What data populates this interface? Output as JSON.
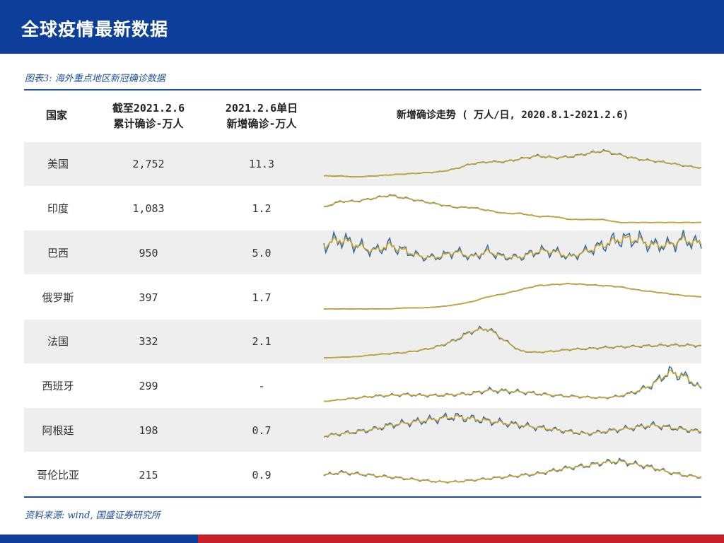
{
  "page": {
    "title": "全球疫情最新数据"
  },
  "figure": {
    "caption": "图表3: 海外重点地区新冠确诊数据",
    "source": "资料来源: wind, 国盛证券研究所"
  },
  "table": {
    "headers": {
      "country": "国家",
      "cumulative_l1": "截至2021.2.6",
      "cumulative_l2": "累计确诊-万人",
      "daily_l1": "2021.2.6单日",
      "daily_l2": "新增确诊-万人",
      "trend": "新增确诊走势 ( 万人/日, 2020.8.1-2021.2.6)"
    },
    "rows": [
      {
        "country": "美国",
        "cumulative": "2,752",
        "daily": "11.3"
      },
      {
        "country": "印度",
        "cumulative": "1,083",
        "daily": "1.2"
      },
      {
        "country": "巴西",
        "cumulative": "950",
        "daily": "5.0"
      },
      {
        "country": "俄罗斯",
        "cumulative": "397",
        "daily": "1.7"
      },
      {
        "country": "法国",
        "cumulative": "332",
        "daily": "2.1"
      },
      {
        "country": "西班牙",
        "cumulative": "299",
        "daily": "-"
      },
      {
        "country": "阿根廷",
        "cumulative": "198",
        "daily": "0.7"
      },
      {
        "country": "哥伦比亚",
        "cumulative": "215",
        "daily": "0.9"
      }
    ]
  },
  "colors": {
    "header_blue": "#0d3f9a",
    "accent_red": "#c8202a",
    "line_blue": "#2e6db4",
    "line_gold": "#c9a227",
    "band_gray": "#eeeeee"
  },
  "chart_data": {
    "type": "line",
    "title": "新增确诊走势 ( 万人/日, 2020.8.1-2021.2.6)",
    "x_range": [
      "2020.8.1",
      "2021.2.6"
    ],
    "sparklines": [
      {
        "country": "美国",
        "keypoints": [
          5,
          5,
          4,
          5,
          6,
          7,
          8,
          9,
          12,
          17,
          19,
          19,
          22,
          25,
          23,
          24,
          27,
          30,
          26,
          22,
          20,
          18,
          15,
          13
        ]
      },
      {
        "country": "印度",
        "keypoints": [
          6,
          8,
          8,
          9,
          10,
          9,
          8,
          7,
          6,
          6,
          5,
          4,
          4,
          3,
          3,
          2,
          2,
          2,
          1,
          1,
          1,
          1,
          1,
          1
        ]
      },
      {
        "country": "巴西",
        "keypoints": [
          4,
          5,
          4,
          3,
          4,
          3,
          2,
          2,
          3,
          2,
          3,
          2,
          2,
          3,
          3,
          2,
          3,
          4,
          5,
          5,
          4,
          4,
          5,
          4
        ]
      },
      {
        "country": "俄罗斯",
        "keypoints": [
          0.5,
          0.5,
          0.5,
          0.5,
          0.5,
          0.6,
          0.6,
          0.7,
          0.9,
          1.2,
          1.7,
          2.0,
          2.4,
          2.8,
          2.9,
          3.0,
          2.9,
          2.8,
          2.7,
          2.4,
          2.2,
          2.0,
          1.8,
          1.7
        ]
      },
      {
        "country": "法国",
        "keypoints": [
          0.1,
          0.2,
          0.3,
          0.6,
          0.8,
          1.0,
          1.4,
          2.0,
          3.0,
          4.5,
          5.0,
          3.0,
          1.2,
          1.0,
          1.2,
          1.5,
          1.6,
          1.8,
          1.9,
          2.0,
          2.1,
          2.2,
          2.2,
          2.1
        ]
      },
      {
        "country": "西班牙",
        "keypoints": [
          0.1,
          0.3,
          0.5,
          0.7,
          0.8,
          0.9,
          0.8,
          0.8,
          0.9,
          1.0,
          1.4,
          1.3,
          1.2,
          1.0,
          0.8,
          0.7,
          0.6,
          0.5,
          0.7,
          1.2,
          2.0,
          3.5,
          3.0,
          1.5
        ]
      },
      {
        "country": "阿根廷",
        "keypoints": [
          0.5,
          0.6,
          0.7,
          0.8,
          1.0,
          1.1,
          1.2,
          1.3,
          1.4,
          1.3,
          1.2,
          1.1,
          1.0,
          0.9,
          0.8,
          0.7,
          0.6,
          0.7,
          0.8,
          0.9,
          1.0,
          0.9,
          0.8,
          0.7
        ]
      },
      {
        "country": "哥伦比亚",
        "keypoints": [
          1.0,
          1.2,
          1.1,
          1.0,
          0.9,
          0.8,
          0.7,
          0.6,
          0.6,
          0.7,
          0.8,
          0.9,
          1.0,
          1.1,
          1.3,
          1.5,
          1.6,
          1.8,
          1.9,
          1.7,
          1.5,
          1.2,
          1.0,
          0.9
        ]
      }
    ]
  }
}
